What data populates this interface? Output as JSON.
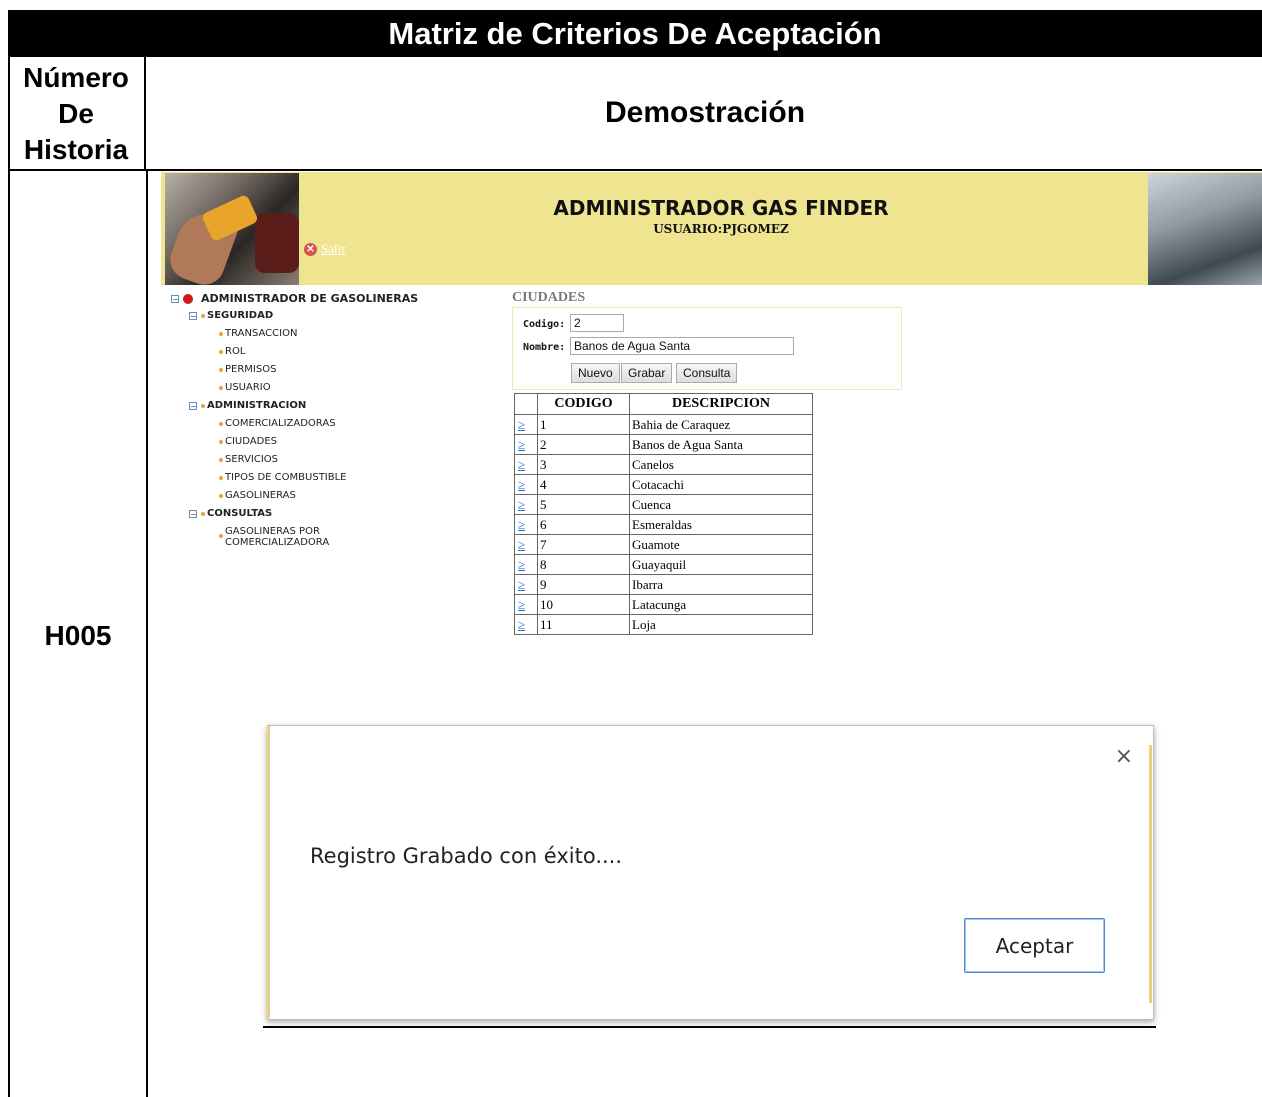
{
  "doc": {
    "title": "Matriz de Criterios De Aceptación",
    "col_number": "Número\nDe\nHistoria",
    "col_number_lines": [
      "Número",
      "De",
      "Historia"
    ],
    "col_demo": "Demostración",
    "story_id": "H005"
  },
  "app": {
    "title": "ADMINISTRADOR GAS FINDER",
    "user": "USUARIO:PJGOMEZ",
    "logout_label": "Salir"
  },
  "tree": {
    "root": "ADMINISTRADOR DE GASOLINERAS",
    "groups": [
      {
        "label": "SEGURIDAD",
        "items": [
          "TRANSACCION",
          "ROL",
          "PERMISOS",
          "USUARIO"
        ]
      },
      {
        "label": "ADMINISTRACION",
        "items": [
          "COMERCIALIZADORAS",
          "CIUDADES",
          "SERVICIOS",
          "TIPOS DE COMBUSTIBLE",
          "GASOLINERAS"
        ]
      },
      {
        "label": "CONSULTAS",
        "items": [
          "GASOLINERAS POR",
          "COMERCIALIZADORA"
        ]
      }
    ]
  },
  "form": {
    "section_title": "CIUDADES",
    "codigo_label": "Codigo:",
    "codigo_value": "2",
    "nombre_label": "Nombre:",
    "nombre_value": "Banos de Agua Santa",
    "btn_nuevo": "Nuevo",
    "btn_grabar": "Grabar",
    "btn_consulta": "Consulta"
  },
  "table": {
    "headers": [
      "",
      "CODIGO",
      "DESCRIPCION"
    ],
    "select_glyph": "≥",
    "rows": [
      {
        "codigo": "1",
        "descripcion": "Bahia de Caraquez"
      },
      {
        "codigo": "2",
        "descripcion": "Banos de Agua Santa"
      },
      {
        "codigo": "3",
        "descripcion": "Canelos"
      },
      {
        "codigo": "4",
        "descripcion": "Cotacachi"
      },
      {
        "codigo": "5",
        "descripcion": "Cuenca"
      },
      {
        "codigo": "6",
        "descripcion": "Esmeraldas"
      },
      {
        "codigo": "7",
        "descripcion": "Guamote"
      },
      {
        "codigo": "8",
        "descripcion": "Guayaquil"
      },
      {
        "codigo": "9",
        "descripcion": "Ibarra"
      },
      {
        "codigo": "10",
        "descripcion": "Latacunga"
      },
      {
        "codigo": "11",
        "descripcion": "Loja"
      }
    ]
  },
  "dialog": {
    "message": "Registro Grabado con éxito....",
    "close_glyph": "×",
    "ok_label": "Aceptar"
  },
  "colors": {
    "header_bg": "#efe490",
    "link_blue": "#2a6fd1",
    "section_grey": "#7a7a7a"
  }
}
